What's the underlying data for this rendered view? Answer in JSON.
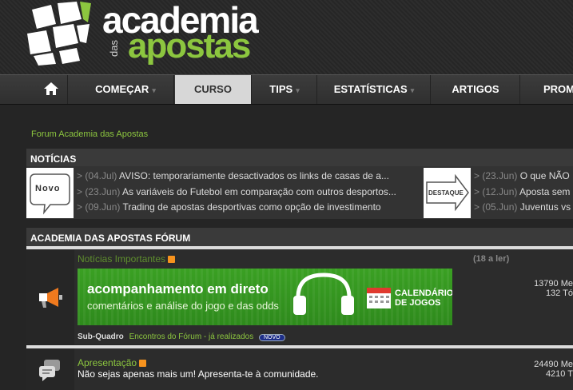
{
  "logo": {
    "line1": "academia",
    "small": "das",
    "line2": "apostas"
  },
  "nav": {
    "items": [
      {
        "label": "COMEÇAR"
      },
      {
        "label": "CURSO"
      },
      {
        "label": "TIPS"
      },
      {
        "label": "ESTATÍSTICAS"
      },
      {
        "label": "ARTIGOS"
      },
      {
        "label": "PROMO"
      }
    ]
  },
  "breadcrumb": "Forum Academia das Apostas",
  "news": {
    "heading": "NOTÍCIAS",
    "badge1": "Novo",
    "badge2": "DESTAQUE",
    "left": [
      {
        "date": "> (04.Jul)",
        "text": "AVISO: temporariamente desactivados os links de casas de a..."
      },
      {
        "date": "> (23.Jun)",
        "text": "As variáveis do Futebol em comparação com outros desportos..."
      },
      {
        "date": "> (09.Jun)",
        "text": "Trading de apostas desportivas como opção de investimento"
      }
    ],
    "right": [
      {
        "date": "> (23.Jun)",
        "text": "O que NÃO"
      },
      {
        "date": "> (12.Jun)",
        "text": "Aposta sem"
      },
      {
        "date": "> (05.Jun)",
        "text": "Juventus vs"
      }
    ]
  },
  "forum": {
    "heading": "ACADEMIA DAS APOSTAS FÓRUM",
    "rows": [
      {
        "title": "Notícias Importantes",
        "unread": "(18 a ler)",
        "banner_line1": "acompanhamento em direto",
        "banner_line2": "comentários e análise do jogo e das odds",
        "banner_cal": "CALENDÁRIO",
        "banner_cal2": "DE JOGOS",
        "subforum_label": "Sub-Quadro",
        "subforum_link": "Encontros do Fórum - já realizados",
        "subforum_badge": "NOVO",
        "stat1": "13790 Me",
        "stat2": "132 Tó"
      },
      {
        "title": "Apresentação",
        "desc": "Não sejas apenas mais um! Apresenta-te à comunidade.",
        "stat1": "24490 Me",
        "stat2": "4210 T"
      }
    ]
  },
  "colors": {
    "accent": "#8cc63f",
    "rss": "#f7931e"
  }
}
